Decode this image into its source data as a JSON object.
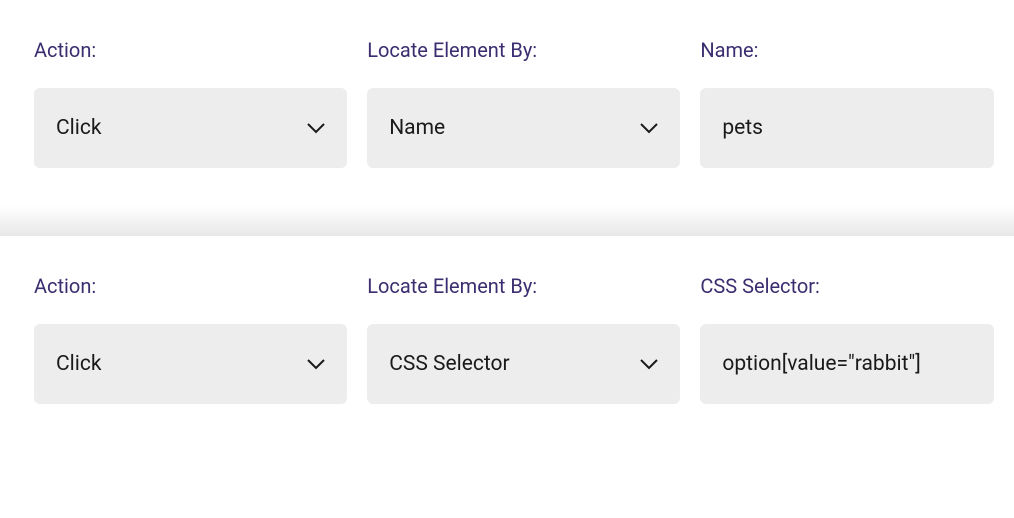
{
  "rows": [
    {
      "action": {
        "label": "Action:",
        "value": "Click"
      },
      "locate": {
        "label": "Locate Element By:",
        "value": "Name"
      },
      "param": {
        "label": "Name:",
        "value": "pets"
      }
    },
    {
      "action": {
        "label": "Action:",
        "value": "Click"
      },
      "locate": {
        "label": "Locate Element By:",
        "value": "CSS Selector"
      },
      "param": {
        "label": "CSS Selector:",
        "value": "option[value=\"rabbit\"]"
      }
    }
  ]
}
